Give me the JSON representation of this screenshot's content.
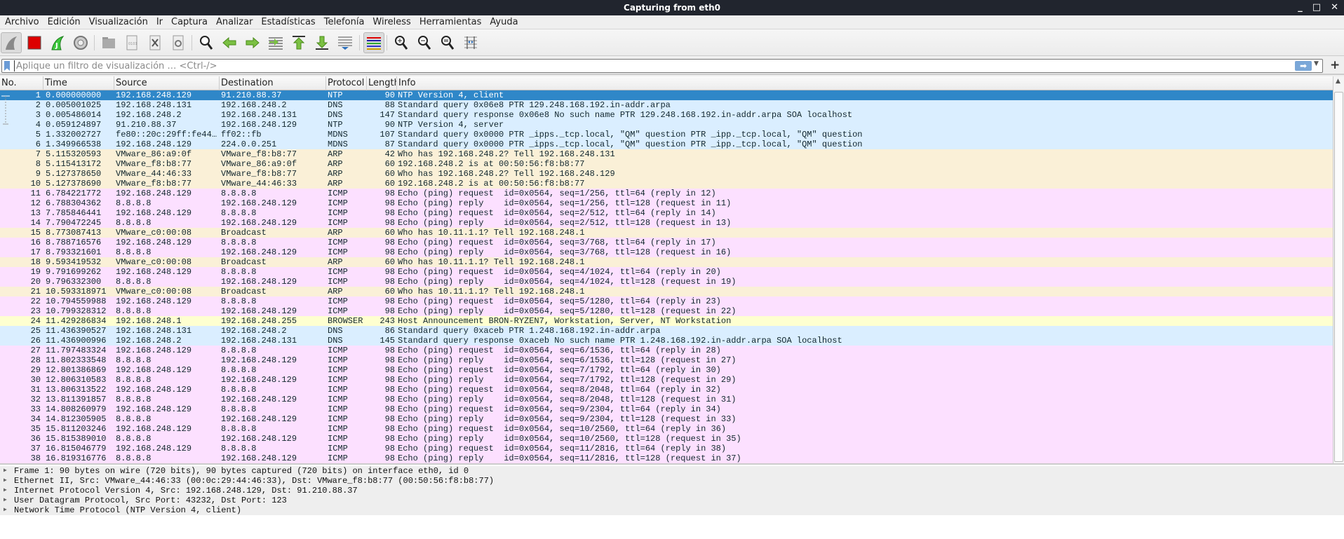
{
  "window": {
    "title": "Capturing from eth0",
    "minimize": "_",
    "maximize": "□",
    "close": "✕"
  },
  "menu": [
    "Archivo",
    "Edición",
    "Visualización",
    "Ir",
    "Captura",
    "Analizar",
    "Estadísticas",
    "Telefonía",
    "Wireless",
    "Herramientas",
    "Ayuda"
  ],
  "toolbar": [
    {
      "icon": "shark-fin-start-icon",
      "active": true
    },
    {
      "icon": "stop-capture-icon"
    },
    {
      "icon": "restart-capture-icon"
    },
    {
      "icon": "capture-options-gear-icon"
    },
    {
      "icon": "open-file-icon"
    },
    {
      "icon": "save-file-icon"
    },
    {
      "icon": "close-file-icon"
    },
    {
      "icon": "reload-file-icon"
    },
    {
      "icon": "find-packet-icon"
    },
    {
      "icon": "go-back-icon"
    },
    {
      "icon": "go-forward-icon"
    },
    {
      "icon": "go-to-packet-icon"
    },
    {
      "icon": "first-packet-icon"
    },
    {
      "icon": "last-packet-icon"
    },
    {
      "icon": "autoscroll-icon"
    },
    {
      "icon": "colorize-icon",
      "active": true
    },
    {
      "icon": "zoom-in-icon"
    },
    {
      "icon": "zoom-out-icon"
    },
    {
      "icon": "normal-size-icon"
    },
    {
      "icon": "resize-columns-icon"
    }
  ],
  "filter": {
    "placeholder": "Aplique un filtro de visualización … <Ctrl-/>",
    "value": "",
    "apply": "➡",
    "plus": "+"
  },
  "colors": {
    "selected": "#2f87c8",
    "udp": "#daeeff",
    "arp": "#faf0d7",
    "icmp": "#fce0ff",
    "browser": "#feffd0"
  },
  "columns": [
    "No.",
    "Time",
    "Source",
    "Destination",
    "Protocol",
    "Length",
    "Info"
  ],
  "packets": [
    [
      "1",
      "0.000000000",
      "192.168.248.129",
      "91.210.88.37",
      "NTP",
      "90",
      "NTP Version 4, client",
      "udp"
    ],
    [
      "2",
      "0.005001025",
      "192.168.248.131",
      "192.168.248.2",
      "DNS",
      "88",
      "Standard query 0x06e8 PTR 129.248.168.192.in-addr.arpa",
      "udp"
    ],
    [
      "3",
      "0.005486014",
      "192.168.248.2",
      "192.168.248.131",
      "DNS",
      "147",
      "Standard query response 0x06e8 No such name PTR 129.248.168.192.in-addr.arpa SOA localhost",
      "udp"
    ],
    [
      "4",
      "0.059124897",
      "91.210.88.37",
      "192.168.248.129",
      "NTP",
      "90",
      "NTP Version 4, server",
      "udp"
    ],
    [
      "5",
      "1.332002727",
      "fe80::20c:29ff:fe44…",
      "ff02::fb",
      "MDNS",
      "107",
      "Standard query 0x0000 PTR _ipps._tcp.local, \"QM\" question PTR _ipp._tcp.local, \"QM\" question",
      "udp"
    ],
    [
      "6",
      "1.349966538",
      "192.168.248.129",
      "224.0.0.251",
      "MDNS",
      "87",
      "Standard query 0x0000 PTR _ipps._tcp.local, \"QM\" question PTR _ipp._tcp.local, \"QM\" question",
      "udp"
    ],
    [
      "7",
      "5.115320593",
      "VMware_86:a9:0f",
      "VMware_f8:b8:77",
      "ARP",
      "42",
      "Who has 192.168.248.2? Tell 192.168.248.131",
      "arp"
    ],
    [
      "8",
      "5.115413172",
      "VMware_f8:b8:77",
      "VMware_86:a9:0f",
      "ARP",
      "60",
      "192.168.248.2 is at 00:50:56:f8:b8:77",
      "arp"
    ],
    [
      "9",
      "5.127378650",
      "VMware_44:46:33",
      "VMware_f8:b8:77",
      "ARP",
      "60",
      "Who has 192.168.248.2? Tell 192.168.248.129",
      "arp"
    ],
    [
      "10",
      "5.127378690",
      "VMware_f8:b8:77",
      "VMware_44:46:33",
      "ARP",
      "60",
      "192.168.248.2 is at 00:50:56:f8:b8:77",
      "arp"
    ],
    [
      "11",
      "6.784221772",
      "192.168.248.129",
      "8.8.8.8",
      "ICMP",
      "98",
      "Echo (ping) request  id=0x0564, seq=1/256, ttl=64 (reply in 12)",
      "icmp"
    ],
    [
      "12",
      "6.788304362",
      "8.8.8.8",
      "192.168.248.129",
      "ICMP",
      "98",
      "Echo (ping) reply    id=0x0564, seq=1/256, ttl=128 (request in 11)",
      "icmp"
    ],
    [
      "13",
      "7.785846441",
      "192.168.248.129",
      "8.8.8.8",
      "ICMP",
      "98",
      "Echo (ping) request  id=0x0564, seq=2/512, ttl=64 (reply in 14)",
      "icmp"
    ],
    [
      "14",
      "7.790472245",
      "8.8.8.8",
      "192.168.248.129",
      "ICMP",
      "98",
      "Echo (ping) reply    id=0x0564, seq=2/512, ttl=128 (request in 13)",
      "icmp"
    ],
    [
      "15",
      "8.773087413",
      "VMware_c0:00:08",
      "Broadcast",
      "ARP",
      "60",
      "Who has 10.11.1.1? Tell 192.168.248.1",
      "arp"
    ],
    [
      "16",
      "8.788716576",
      "192.168.248.129",
      "8.8.8.8",
      "ICMP",
      "98",
      "Echo (ping) request  id=0x0564, seq=3/768, ttl=64 (reply in 17)",
      "icmp"
    ],
    [
      "17",
      "8.793321601",
      "8.8.8.8",
      "192.168.248.129",
      "ICMP",
      "98",
      "Echo (ping) reply    id=0x0564, seq=3/768, ttl=128 (request in 16)",
      "icmp"
    ],
    [
      "18",
      "9.593419532",
      "VMware_c0:00:08",
      "Broadcast",
      "ARP",
      "60",
      "Who has 10.11.1.1? Tell 192.168.248.1",
      "arp"
    ],
    [
      "19",
      "9.791699262",
      "192.168.248.129",
      "8.8.8.8",
      "ICMP",
      "98",
      "Echo (ping) request  id=0x0564, seq=4/1024, ttl=64 (reply in 20)",
      "icmp"
    ],
    [
      "20",
      "9.796332300",
      "8.8.8.8",
      "192.168.248.129",
      "ICMP",
      "98",
      "Echo (ping) reply    id=0x0564, seq=4/1024, ttl=128 (request in 19)",
      "icmp"
    ],
    [
      "21",
      "10.593318971",
      "VMware_c0:00:08",
      "Broadcast",
      "ARP",
      "60",
      "Who has 10.11.1.1? Tell 192.168.248.1",
      "arp"
    ],
    [
      "22",
      "10.794559988",
      "192.168.248.129",
      "8.8.8.8",
      "ICMP",
      "98",
      "Echo (ping) request  id=0x0564, seq=5/1280, ttl=64 (reply in 23)",
      "icmp"
    ],
    [
      "23",
      "10.799328312",
      "8.8.8.8",
      "192.168.248.129",
      "ICMP",
      "98",
      "Echo (ping) reply    id=0x0564, seq=5/1280, ttl=128 (request in 22)",
      "icmp"
    ],
    [
      "24",
      "11.429286834",
      "192.168.248.1",
      "192.168.248.255",
      "BROWSER",
      "243",
      "Host Announcement BRON-RYZEN7, Workstation, Server, NT Workstation",
      "browser"
    ],
    [
      "25",
      "11.436390527",
      "192.168.248.131",
      "192.168.248.2",
      "DNS",
      "86",
      "Standard query 0xaceb PTR 1.248.168.192.in-addr.arpa",
      "udp"
    ],
    [
      "26",
      "11.436900996",
      "192.168.248.2",
      "192.168.248.131",
      "DNS",
      "145",
      "Standard query response 0xaceb No such name PTR 1.248.168.192.in-addr.arpa SOA localhost",
      "udp"
    ],
    [
      "27",
      "11.797483324",
      "192.168.248.129",
      "8.8.8.8",
      "ICMP",
      "98",
      "Echo (ping) request  id=0x0564, seq=6/1536, ttl=64 (reply in 28)",
      "icmp"
    ],
    [
      "28",
      "11.802333548",
      "8.8.8.8",
      "192.168.248.129",
      "ICMP",
      "98",
      "Echo (ping) reply    id=0x0564, seq=6/1536, ttl=128 (request in 27)",
      "icmp"
    ],
    [
      "29",
      "12.801386869",
      "192.168.248.129",
      "8.8.8.8",
      "ICMP",
      "98",
      "Echo (ping) request  id=0x0564, seq=7/1792, ttl=64 (reply in 30)",
      "icmp"
    ],
    [
      "30",
      "12.806310583",
      "8.8.8.8",
      "192.168.248.129",
      "ICMP",
      "98",
      "Echo (ping) reply    id=0x0564, seq=7/1792, ttl=128 (request in 29)",
      "icmp"
    ],
    [
      "31",
      "13.806313522",
      "192.168.248.129",
      "8.8.8.8",
      "ICMP",
      "98",
      "Echo (ping) request  id=0x0564, seq=8/2048, ttl=64 (reply in 32)",
      "icmp"
    ],
    [
      "32",
      "13.811391857",
      "8.8.8.8",
      "192.168.248.129",
      "ICMP",
      "98",
      "Echo (ping) reply    id=0x0564, seq=8/2048, ttl=128 (request in 31)",
      "icmp"
    ],
    [
      "33",
      "14.808260979",
      "192.168.248.129",
      "8.8.8.8",
      "ICMP",
      "98",
      "Echo (ping) request  id=0x0564, seq=9/2304, ttl=64 (reply in 34)",
      "icmp"
    ],
    [
      "34",
      "14.812305905",
      "8.8.8.8",
      "192.168.248.129",
      "ICMP",
      "98",
      "Echo (ping) reply    id=0x0564, seq=9/2304, ttl=128 (request in 33)",
      "icmp"
    ],
    [
      "35",
      "15.811203246",
      "192.168.248.129",
      "8.8.8.8",
      "ICMP",
      "98",
      "Echo (ping) request  id=0x0564, seq=10/2560, ttl=64 (reply in 36)",
      "icmp"
    ],
    [
      "36",
      "15.815389010",
      "8.8.8.8",
      "192.168.248.129",
      "ICMP",
      "98",
      "Echo (ping) reply    id=0x0564, seq=10/2560, ttl=128 (request in 35)",
      "icmp"
    ],
    [
      "37",
      "16.815046779",
      "192.168.248.129",
      "8.8.8.8",
      "ICMP",
      "98",
      "Echo (ping) request  id=0x0564, seq=11/2816, ttl=64 (reply in 38)",
      "icmp"
    ],
    [
      "38",
      "16.819316776",
      "8.8.8.8",
      "192.168.248.129",
      "ICMP",
      "98",
      "Echo (ping) reply    id=0x0564, seq=11/2816, ttl=128 (request in 37)",
      "icmp"
    ]
  ],
  "selected_packet": "1",
  "details": [
    "Frame 1: 90 bytes on wire (720 bits), 90 bytes captured (720 bits) on interface eth0, id 0",
    "Ethernet II, Src: VMware_44:46:33 (00:0c:29:44:46:33), Dst: VMware_f8:b8:77 (00:50:56:f8:b8:77)",
    "Internet Protocol Version 4, Src: 192.168.248.129, Dst: 91.210.88.37",
    "User Datagram Protocol, Src Port: 43232, Dst Port: 123",
    "Network Time Protocol (NTP Version 4, client)"
  ]
}
